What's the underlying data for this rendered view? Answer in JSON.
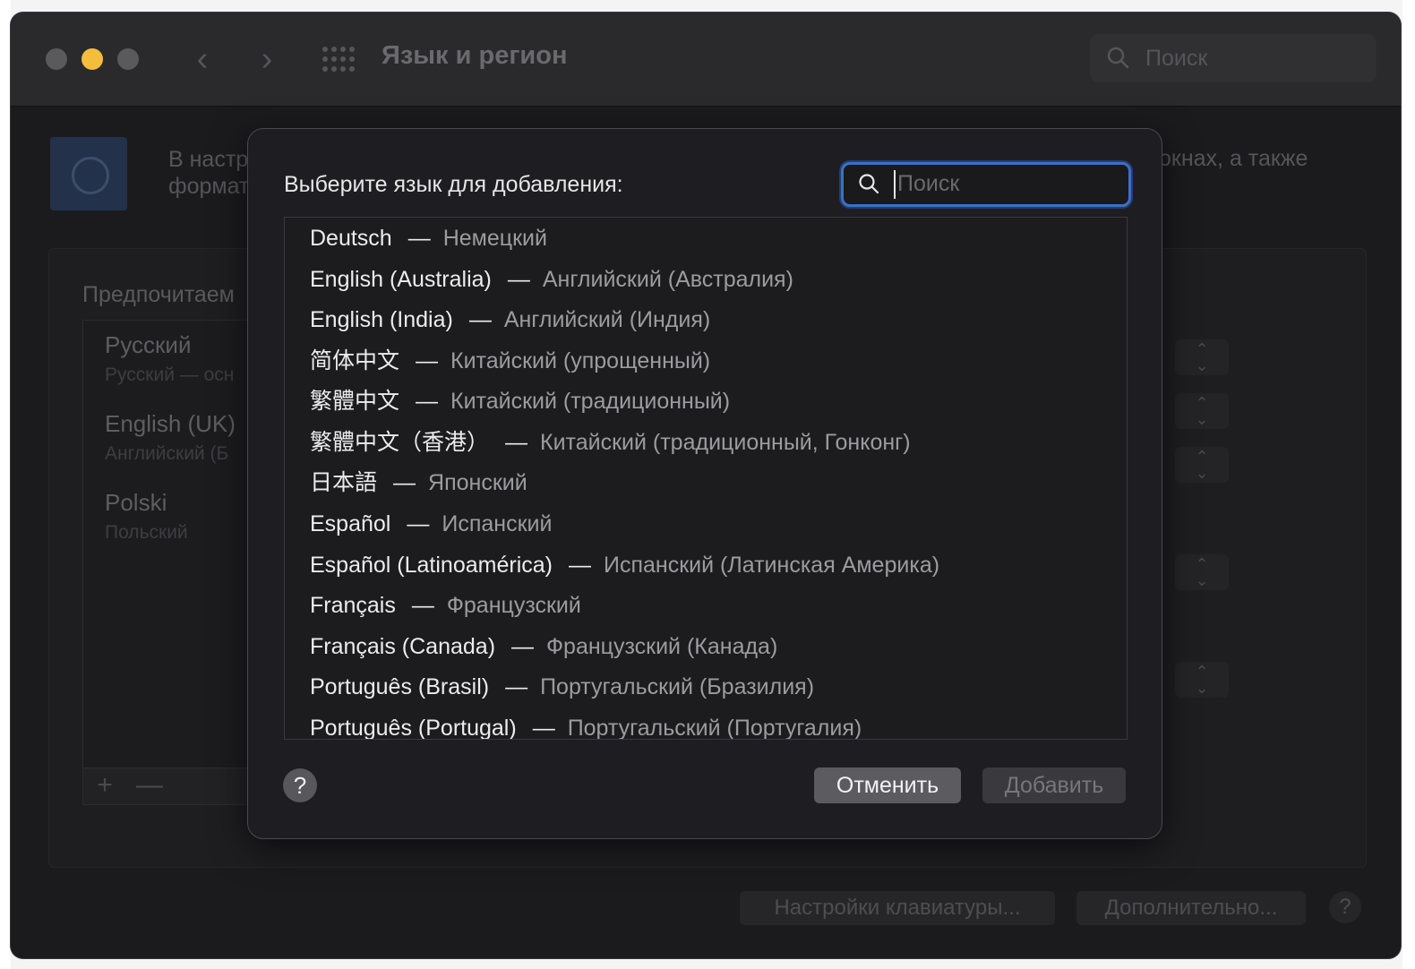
{
  "window": {
    "title": "Язык и регион",
    "search_placeholder": "Поиск"
  },
  "background": {
    "intro_left_line1": "В настр",
    "intro_left_line2": "формат",
    "intro_right": "окнах, а также",
    "preferred_title": "Предпочитаем",
    "languages": [
      {
        "name": "Русский",
        "sub": "Русский — осн"
      },
      {
        "name": "English (UK)",
        "sub": "Английский (Б"
      },
      {
        "name": "Polski",
        "sub": "Польский"
      }
    ],
    "list_add": "+",
    "list_remove": "—",
    "keyboard_button": "Настройки клавиатуры...",
    "advanced_button": "Дополнительно...",
    "help": "?"
  },
  "sheet": {
    "label": "Выберите язык для добавления:",
    "search_placeholder": "Поиск",
    "dash": "—",
    "languages": [
      {
        "native": "Deutsch",
        "localized": "Немецкий"
      },
      {
        "native": "English (Australia)",
        "localized": "Английский (Австралия)"
      },
      {
        "native": "English (India)",
        "localized": "Английский (Индия)"
      },
      {
        "native": "简体中文",
        "localized": "Китайский (упрощенный)"
      },
      {
        "native": "繁體中文",
        "localized": "Китайский (традиционный)"
      },
      {
        "native": "繁體中文（香港）",
        "localized": "Китайский (традиционный, Гонконг)"
      },
      {
        "native": "日本語",
        "localized": "Японский"
      },
      {
        "native": "Español",
        "localized": "Испанский"
      },
      {
        "native": "Español (Latinoamérica)",
        "localized": "Испанский (Латинская Америка)"
      },
      {
        "native": "Français",
        "localized": "Французский"
      },
      {
        "native": "Français (Canada)",
        "localized": "Французский (Канада)"
      },
      {
        "native": "Português (Brasil)",
        "localized": "Португальский (Бразилия)"
      },
      {
        "native": "Português (Portugal)",
        "localized": "Португальский (Португалия)"
      }
    ],
    "help": "?",
    "cancel": "Отменить",
    "add": "Добавить"
  }
}
